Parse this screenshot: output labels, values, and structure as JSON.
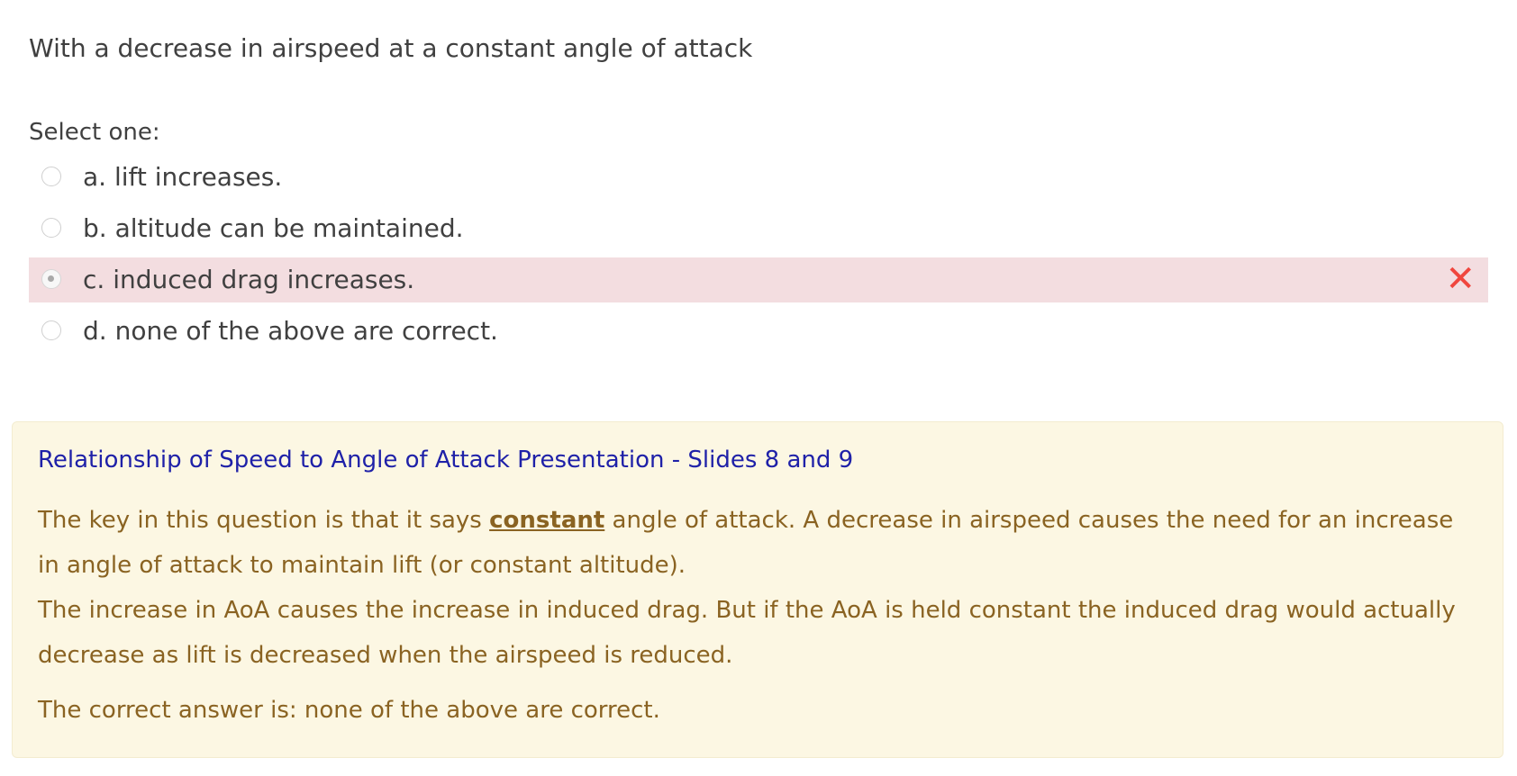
{
  "question": {
    "text": "With a decrease in airspeed at a constant angle of attack"
  },
  "prompt": "Select one:",
  "answers": [
    {
      "label": "a. lift increases.",
      "selected": false
    },
    {
      "label": "b. altitude can be maintained.",
      "selected": false
    },
    {
      "label": "c. induced drag increases.",
      "selected": true,
      "result": "incorrect"
    },
    {
      "label": "d. none of the above are correct.",
      "selected": false
    }
  ],
  "feedback": {
    "link_text": "Relationship of Speed to Angle of Attack Presentation - Slides 8 and 9",
    "para1_before": "The key in this question is that it says ",
    "para1_emphasis": "constant",
    "para1_after": " angle of attack. A decrease in airspeed causes the need for an increase in angle of attack to maintain lift (or constant altitude).",
    "para2": "The increase in AoA causes the increase in induced drag. But if the AoA is held constant the induced drag would actually decrease as lift is decreased when the airspeed is reduced.",
    "correct_answer": "The correct answer is: none of the above are correct."
  },
  "colors": {
    "incorrect_highlight": "#f3dde0",
    "incorrect_mark": "#f0463e",
    "feedback_background": "#fcf7e3",
    "feedback_text": "#8a6322",
    "link": "#1f21a8"
  },
  "icons": {
    "incorrect_mark": "close-x-icon"
  }
}
